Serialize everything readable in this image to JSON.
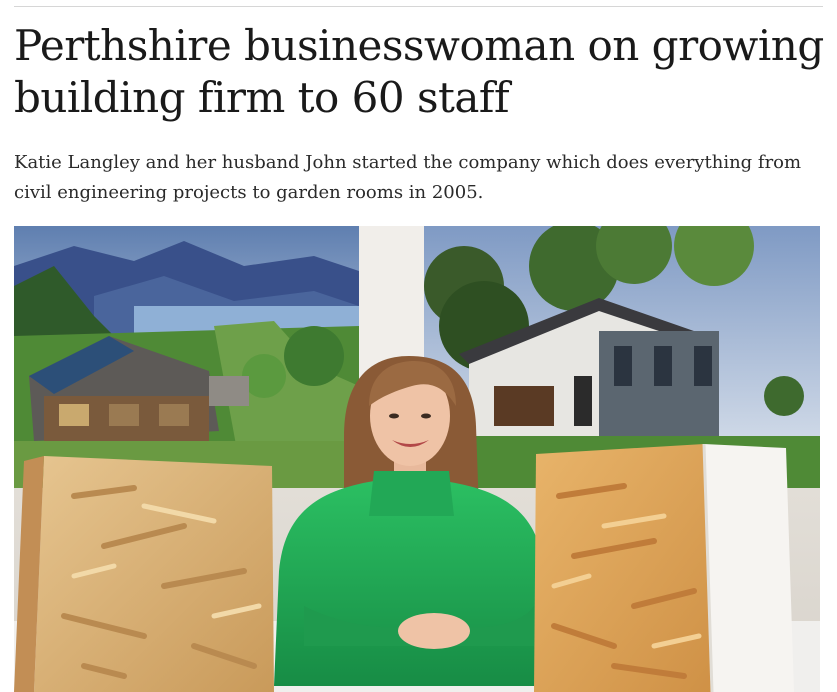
{
  "article": {
    "headline": "Perthshire businesswoman on growing building firm to 60 staff",
    "standfirst": "Katie Langley and her husband John started the company which does everything from civil engineering projects to garden rooms in 2005."
  },
  "image": {
    "subject": "photo-of-woman-with-insulated-panels"
  },
  "colors": {
    "text": "#1a1a1a",
    "rule": "#d6d6d6",
    "sweater": "#1fa653",
    "panel_osb": "#d9b070"
  }
}
